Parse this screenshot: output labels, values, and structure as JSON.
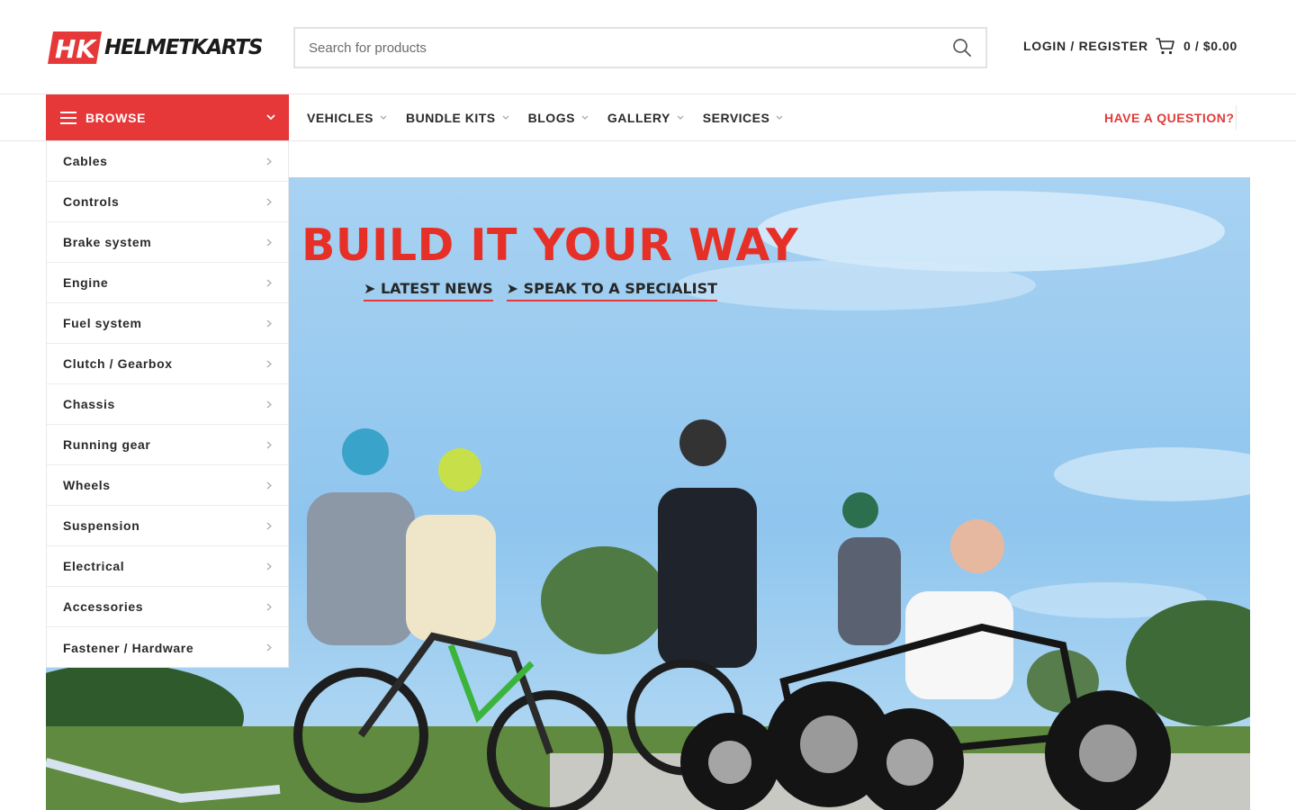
{
  "header": {
    "logo": {
      "mark": "HK",
      "text": "HELMETKARTS"
    },
    "search": {
      "placeholder": "Search for products",
      "icon": "search-icon"
    },
    "login_label": "LOGIN / REGISTER",
    "cart": {
      "icon": "cart-icon",
      "label": "0 / $0.00"
    }
  },
  "nav": {
    "browse_label": "BROWSE",
    "items": [
      {
        "label": "VEHICLES"
      },
      {
        "label": "BUNDLE KITS"
      },
      {
        "label": "BLOGS"
      },
      {
        "label": "GALLERY"
      },
      {
        "label": "SERVICES"
      }
    ],
    "question_label": "HAVE A QUESTION?"
  },
  "categories": [
    "Cables",
    "Controls",
    "Brake system",
    "Engine",
    "Fuel system",
    "Clutch / Gearbox",
    "Chassis",
    "Running gear",
    "Wheels",
    "Suspension",
    "Electrical",
    "Accessories",
    "Fastener / Hardware"
  ],
  "hero": {
    "headline": "BUILD IT YOUR WAY",
    "links": [
      {
        "arrow": "➤",
        "label": "LATEST NEWS"
      },
      {
        "arrow": "➤",
        "label": "SPEAK TO A SPECIALIST"
      }
    ]
  },
  "colors": {
    "brand_red": "#e63838",
    "headline_red": "#e63027",
    "text_dark": "#2a2a2a"
  }
}
